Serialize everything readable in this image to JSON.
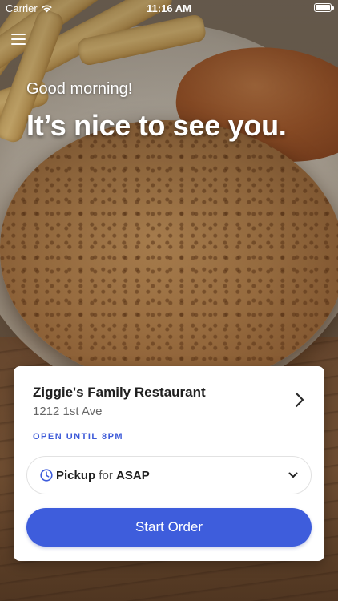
{
  "status_bar": {
    "carrier": "Carrier",
    "time": "11:16 AM"
  },
  "header": {
    "menu_icon": "hamburger-menu-icon",
    "greeting": "Good morning!",
    "headline": "It’s nice to see you."
  },
  "location_card": {
    "name": "Ziggie's Family Restaurant",
    "address": "1212 1st Ave",
    "open_status": "OPEN UNTIL 8PM",
    "chevron_icon": "chevron-right-icon",
    "order_type": {
      "icon": "clock-icon",
      "mode": "Pickup",
      "connector": "for",
      "time": "ASAP",
      "dropdown_icon": "chevron-down-icon"
    },
    "primary_button": "Start Order"
  },
  "colors": {
    "accent": "#3e5ddc",
    "open_status": "#3d5ad8",
    "text_primary": "#1f1f1f",
    "text_secondary": "#666666",
    "card_bg": "#ffffff"
  }
}
